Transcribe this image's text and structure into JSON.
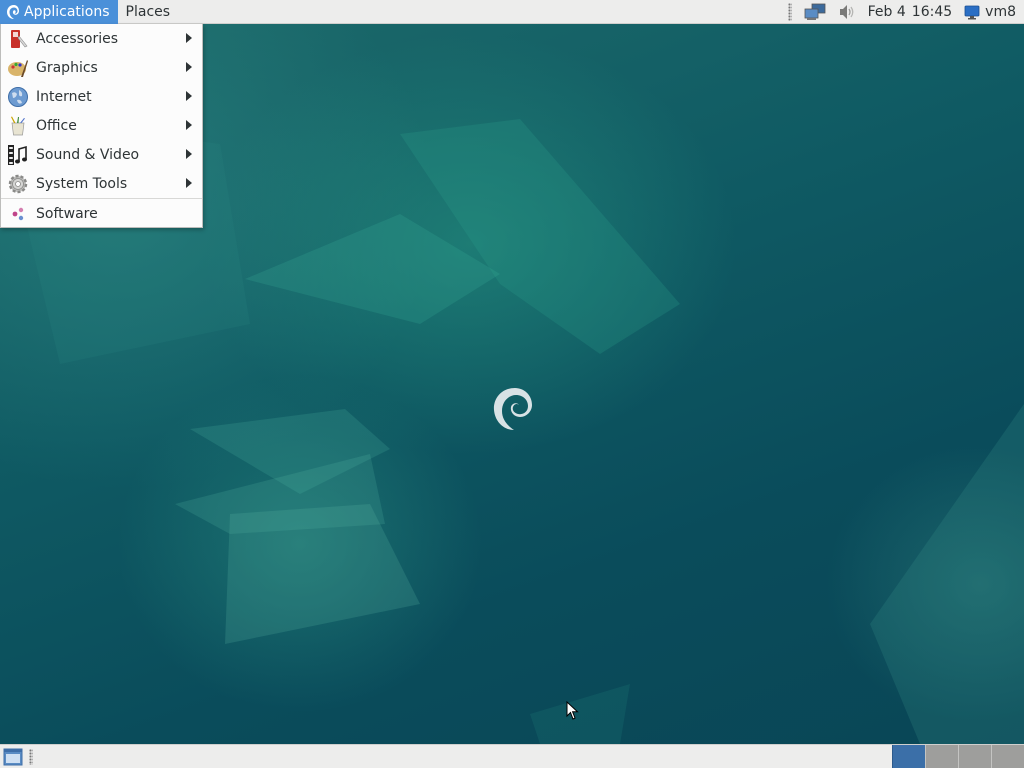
{
  "top_panel": {
    "applications_label": "Applications",
    "places_label": "Places",
    "clock_date": "Feb 4",
    "clock_time": "16:45",
    "user_name": "vm8",
    "tray_icons": [
      "network-icon",
      "volume-icon",
      "display-icon"
    ]
  },
  "menu": {
    "items": [
      {
        "label": "Accessories",
        "icon": "accessories-icon",
        "has_submenu": true
      },
      {
        "label": "Graphics",
        "icon": "graphics-icon",
        "has_submenu": true
      },
      {
        "label": "Internet",
        "icon": "internet-globe-icon",
        "has_submenu": true
      },
      {
        "label": "Office",
        "icon": "office-icon",
        "has_submenu": true
      },
      {
        "label": "Sound & Video",
        "icon": "film-strip-icon",
        "has_submenu": true
      },
      {
        "label": "System Tools",
        "icon": "gear-icon",
        "has_submenu": true
      },
      {
        "label": "Software",
        "icon": "software-icon",
        "has_submenu": false
      }
    ]
  },
  "bottom_panel": {
    "workspaces_count": 4,
    "active_workspace": 1
  },
  "colors": {
    "panel_bg": "#ededec",
    "accent": "#4a90d9",
    "desktop_bg": "#0a4c5b",
    "active_workspace": "#3b6fa8"
  }
}
